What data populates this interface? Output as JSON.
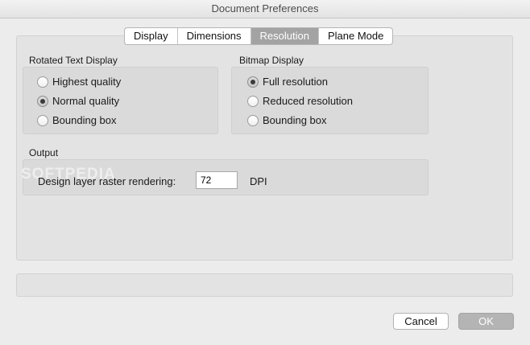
{
  "window": {
    "title": "Document Preferences"
  },
  "tabs": [
    {
      "label": "Display",
      "active": false
    },
    {
      "label": "Dimensions",
      "active": false
    },
    {
      "label": "Resolution",
      "active": true
    },
    {
      "label": "Plane Mode",
      "active": false
    }
  ],
  "rotated_text": {
    "label": "Rotated Text Display",
    "options": [
      {
        "label": "Highest quality",
        "checked": false
      },
      {
        "label": "Normal quality",
        "checked": true
      },
      {
        "label": "Bounding box",
        "checked": false
      }
    ]
  },
  "bitmap": {
    "label": "Bitmap Display",
    "options": [
      {
        "label": "Full resolution",
        "checked": true
      },
      {
        "label": "Reduced resolution",
        "checked": false
      },
      {
        "label": "Bounding box",
        "checked": false
      }
    ]
  },
  "output": {
    "label": "Output",
    "raster_label": "Design layer raster rendering:",
    "raster_value": "72",
    "unit": "DPI"
  },
  "buttons": {
    "cancel": "Cancel",
    "ok": "OK"
  },
  "watermark": "SOFTPEDIA",
  "colors": {
    "selected_tab": "#a3a3a3",
    "default_button": "#b4b4b4"
  }
}
